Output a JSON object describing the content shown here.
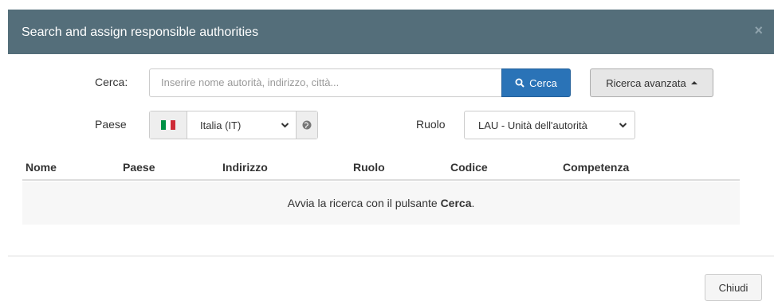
{
  "dialog": {
    "title": "Search and assign responsible authorities",
    "close_symbol": "×"
  },
  "search": {
    "label": "Cerca:",
    "placeholder": "Inserire nome autorità, indirizzo, città...",
    "button_label": "Cerca",
    "advanced_label": "Ricerca avanzata"
  },
  "country": {
    "label": "Paese",
    "selected": "Italia (IT)",
    "flag_colors": [
      "#009246",
      "#ffffff",
      "#ce2b37"
    ]
  },
  "role": {
    "label": "Ruolo",
    "selected": "LAU - Unità dell'autorità"
  },
  "table": {
    "columns": [
      "Nome",
      "Paese",
      "Indirizzo",
      "Ruolo",
      "Codice",
      "Competenza"
    ],
    "empty_prefix": "Avvia la ricerca con il pulsante ",
    "empty_bold": "Cerca",
    "empty_suffix": "."
  },
  "footer": {
    "close_label": "Chiudi"
  },
  "colors": {
    "header_bg": "#546e7a",
    "primary": "#2a73b7"
  }
}
